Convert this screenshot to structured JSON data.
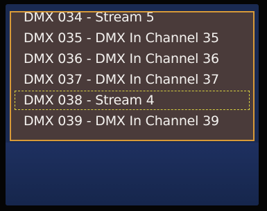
{
  "list": {
    "items": [
      {
        "label": "DMX 034 - Stream 5",
        "selected": false
      },
      {
        "label": "DMX 035 - DMX In Channel 35",
        "selected": false
      },
      {
        "label": "DMX 036 - DMX In Channel 36",
        "selected": false
      },
      {
        "label": "DMX 037 - DMX In Channel 37",
        "selected": false
      },
      {
        "label": "DMX 038 - Stream 4",
        "selected": true
      },
      {
        "label": "DMX 039 - DMX In Channel 39",
        "selected": false
      }
    ]
  },
  "colors": {
    "panel_border": "#d89a38",
    "panel_bg": "#4a3b3a",
    "selection_outline": "#d8d040",
    "screen_bg": "#1a2a52"
  }
}
